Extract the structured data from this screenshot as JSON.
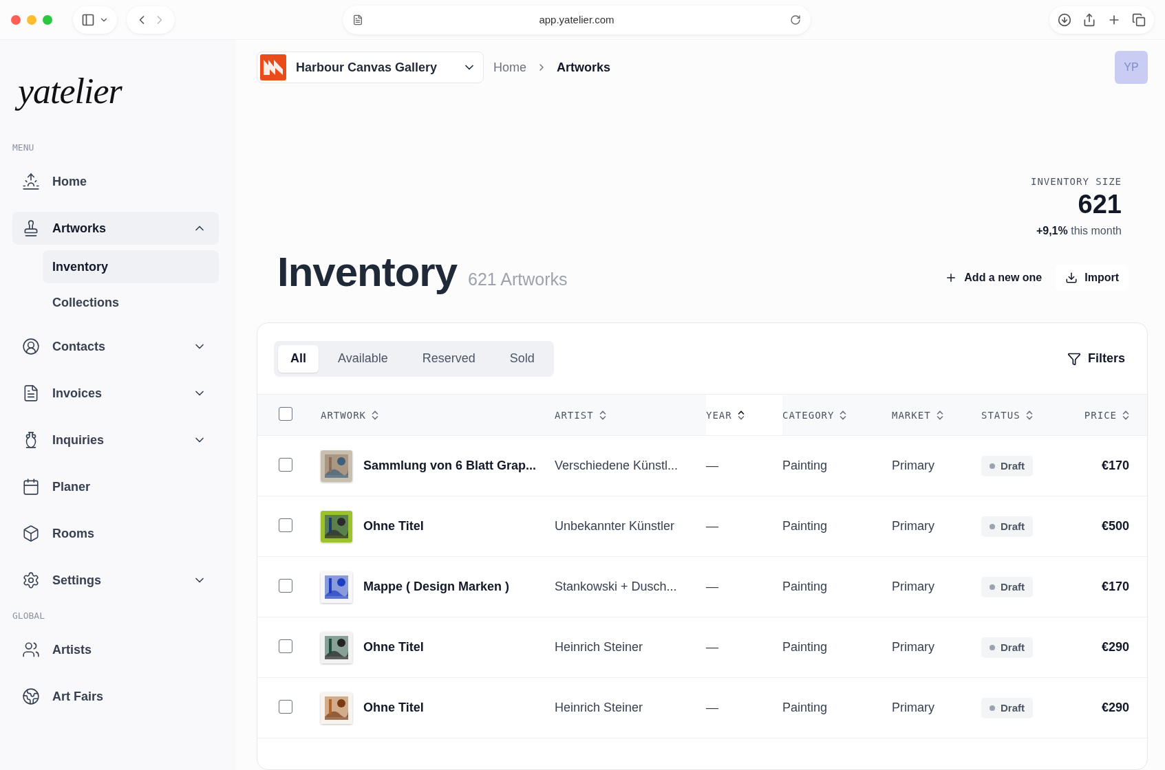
{
  "browser": {
    "url": "app.yatelier.com"
  },
  "brand": "yatelier",
  "gallery": {
    "name": "Harbour Canvas Gallery"
  },
  "breadcrumbs": [
    "Home",
    "Artworks"
  ],
  "avatar": "YP",
  "sidebar": [
    {
      "heading": "MENU",
      "items": [
        {
          "label": "Home",
          "selected": false
        },
        {
          "label": "Artworks",
          "selected": true,
          "expanded": true,
          "children": [
            {
              "label": "Inventory",
              "selected": true
            },
            {
              "label": "Collections",
              "selected": false
            }
          ]
        },
        {
          "label": "Contacts",
          "selected": false,
          "expanded": false
        },
        {
          "label": "Invoices",
          "selected": false,
          "expanded": false
        },
        {
          "label": "Inquiries",
          "selected": false,
          "expanded": false
        },
        {
          "label": "Planer",
          "selected": false
        },
        {
          "label": "Rooms",
          "selected": false
        },
        {
          "label": "Settings",
          "selected": false,
          "expanded": false
        }
      ]
    },
    {
      "heading": "GLOBAL",
      "items": [
        {
          "label": "Artists",
          "selected": false
        },
        {
          "label": "Art Fairs",
          "selected": false
        }
      ]
    }
  ],
  "stats": {
    "label": "INVENTORY SIZE",
    "value": "621",
    "change": "+9,1%",
    "change_note": "this month"
  },
  "title": "Inventory",
  "count": "621 Artworks",
  "actions": [
    {
      "kind": "add",
      "label": "Add a new one"
    },
    {
      "kind": "import",
      "label": "Import"
    }
  ],
  "tabs": [
    {
      "label": "All",
      "selected": true
    },
    {
      "label": "Available",
      "selected": false
    },
    {
      "label": "Reserved",
      "selected": false
    },
    {
      "label": "Sold",
      "selected": false
    }
  ],
  "filters": "Filters",
  "table": {
    "select_all": {
      "checked": false
    },
    "columns": [
      {
        "label": "ARTWORK",
        "sorted": false
      },
      {
        "label": "ARTIST",
        "sorted": false
      },
      {
        "label": "YEAR",
        "sorted": true
      },
      {
        "label": "CATEGORY",
        "sorted": false
      },
      {
        "label": "MARKET",
        "sorted": false
      },
      {
        "label": "STATUS",
        "sorted": false
      },
      {
        "label": "PRICE",
        "sorted": false
      }
    ],
    "rows": [
      {
        "checked": false,
        "artwork": "Sammlung von 6 Blatt Grap...",
        "artist": "Verschiedene Künstl...",
        "year": "—",
        "category": "Painting",
        "market": "Primary",
        "status": "Draft",
        "price": "€170"
      },
      {
        "checked": false,
        "artwork": "Ohne Titel",
        "artist": "Unbekannter Künstler",
        "year": "—",
        "category": "Painting",
        "market": "Primary",
        "status": "Draft",
        "price": "€500"
      },
      {
        "checked": false,
        "artwork": "Mappe ( Design Marken )",
        "artist": "Stankowski + Dusch...",
        "year": "—",
        "category": "Painting",
        "market": "Primary",
        "status": "Draft",
        "price": "€170"
      },
      {
        "checked": false,
        "artwork": "Ohne Titel",
        "artist": "Heinrich Steiner",
        "year": "—",
        "category": "Painting",
        "market": "Primary",
        "status": "Draft",
        "price": "€290"
      },
      {
        "checked": false,
        "artwork": "Ohne Titel",
        "artist": "Heinrich Steiner",
        "year": "—",
        "category": "Painting",
        "market": "Primary",
        "status": "Draft",
        "price": "€290"
      }
    ]
  }
}
